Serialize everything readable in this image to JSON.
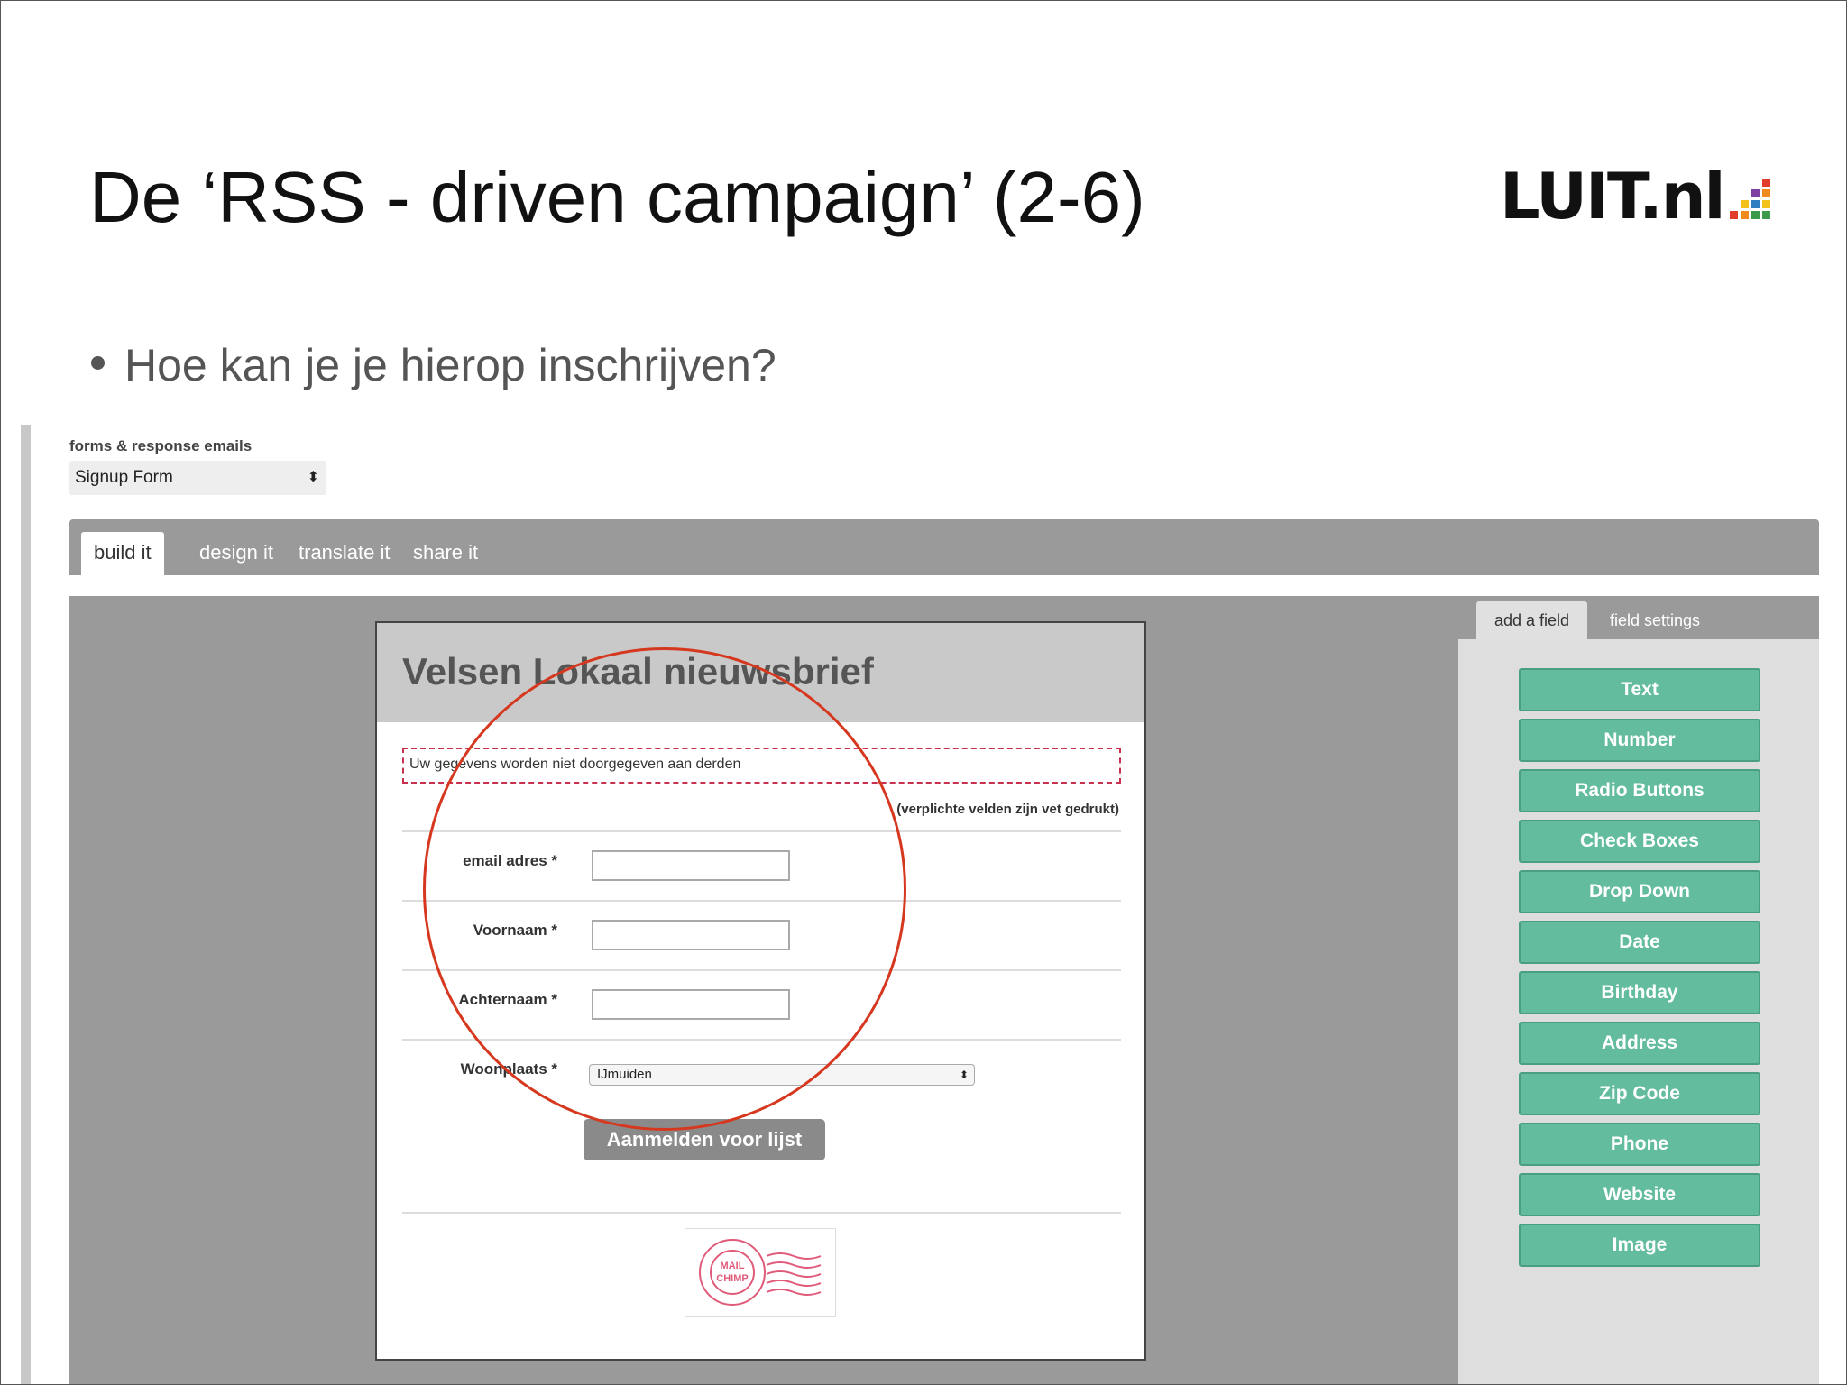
{
  "slide": {
    "title": "De ‘RSS - driven campaign’ (2-6)",
    "bullet": "Hoe kan je je hierop inschrijven?",
    "logo_text": "LUIT.nl"
  },
  "app": {
    "section_label": "forms & response emails",
    "form_select_value": "Signup Form",
    "tabs": [
      "build it",
      "design it",
      "translate it",
      "share it"
    ],
    "active_tab": "build it",
    "side_tabs": [
      "add a field",
      "field settings"
    ],
    "field_buttons": [
      "Text",
      "Number",
      "Radio Buttons",
      "Check Boxes",
      "Drop Down",
      "Date",
      "Birthday",
      "Address",
      "Zip Code",
      "Phone",
      "Website",
      "Image"
    ],
    "accent_color": "#63bc9e"
  },
  "form": {
    "title": "Velsen Lokaal nieuwsbrief",
    "notice": "Uw gegevens worden niet doorgegeven aan derden",
    "required_note": "(verplichte velden zijn vet gedrukt)",
    "fields": [
      {
        "label": "email adres *",
        "value": ""
      },
      {
        "label": "Voornaam *",
        "value": ""
      },
      {
        "label": "Achternaam *",
        "value": ""
      },
      {
        "label": "Woonplaats *",
        "value": "IJmuiden"
      }
    ],
    "submit_label": "Aanmelden voor lijst",
    "stamp_text": "DELIVERED BY MAIL CHIMP"
  },
  "annotation": {
    "color": "#d6381f"
  }
}
